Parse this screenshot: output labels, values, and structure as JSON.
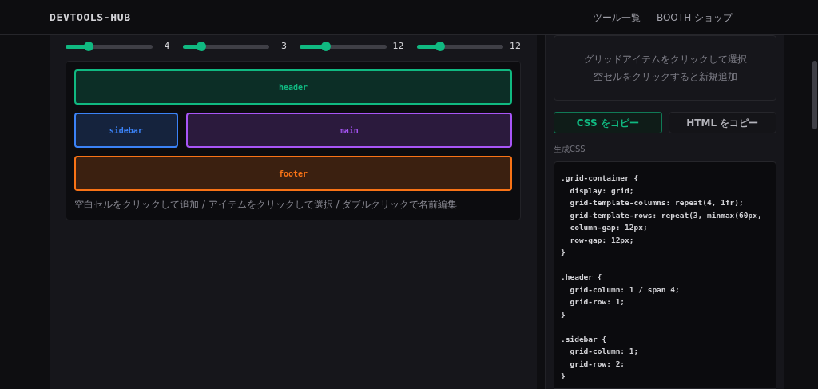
{
  "nav": {
    "logo": "DEVTOOLS-HUB",
    "links": [
      "ツール一覧",
      "BOOTH ショップ"
    ]
  },
  "sliders": [
    {
      "level": 0.27,
      "reading": "4"
    },
    {
      "level": 0.22,
      "reading": "3"
    },
    {
      "level": 0.3,
      "reading": "12"
    },
    {
      "level": 0.27,
      "reading": "12"
    }
  ],
  "grid_items": [
    {
      "name": "header",
      "color": "#10b981"
    },
    {
      "name": "sidebar",
      "color": "#3b82f6"
    },
    {
      "name": "main",
      "color": "#a855f7"
    },
    {
      "name": "footer",
      "color": "#f97316"
    }
  ],
  "grid_hint": "空白セルをクリックして追加 / アイテムをクリックして選択 / ダブルクリックで名前編集",
  "selection_hint": [
    "グリッドアイテムをクリックして選択",
    "空セルをクリックすると新規追加"
  ],
  "copy_buttons": [
    {
      "label": "CSS をコピー",
      "selected": true
    },
    {
      "label": "HTML をコピー",
      "selected": false
    }
  ],
  "code_label": "生成CSS",
  "code_blocks": [
    [
      ".grid-container {",
      "  display: grid;",
      "  grid-template-columns: repeat(4, 1fr);",
      "  grid-template-rows: repeat(3, minmax(60px,",
      "  column-gap: 12px;",
      "  row-gap: 12px;",
      "}"
    ],
    [
      ".header {",
      "  grid-column: 1 / span 4;",
      "  grid-row: 1;",
      "}"
    ],
    [
      ".sidebar {",
      "  grid-column: 1;",
      "  grid-row: 2;",
      "}"
    ]
  ]
}
